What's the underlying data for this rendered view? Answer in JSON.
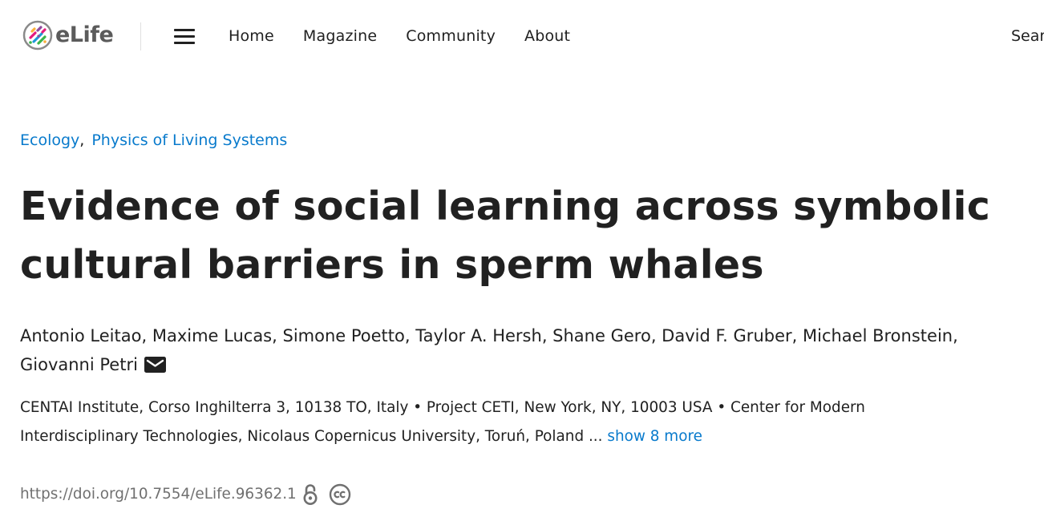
{
  "header": {
    "logo_text": "eLife",
    "nav": [
      {
        "label": "Home"
      },
      {
        "label": "Magazine"
      },
      {
        "label": "Community"
      },
      {
        "label": "About"
      }
    ],
    "search_label": "Search"
  },
  "article": {
    "subjects": [
      {
        "label": "Ecology"
      },
      {
        "label": "Physics of Living Systems"
      }
    ],
    "subject_separator": ",",
    "title_line1": "Evidence of social learning across symbolic",
    "title_line2": "cultural barriers in sperm whales",
    "authors": [
      "Antonio Leitao",
      "Maxime Lucas",
      "Simone Poetto",
      "Taylor A. Hersh",
      "Shane Gero",
      "David F. Gruber",
      "Michael Bronstein",
      "Giovanni Petri"
    ],
    "author_separator": ", ",
    "affiliations_text": "CENTAI Institute, Corso Inghilterra 3, 10138 TO, Italy • Project CETI, New York, NY, 10003 USA • Center for Modern Interdisciplinary Technologies, Nicolaus Copernicus University, Toruń, Poland ...",
    "show_more_label": "show 8 more",
    "doi": "https://doi.org/10.7554/eLife.96362.1"
  },
  "icons": {
    "menu": "hamburger-menu-icon",
    "email": "mail-icon",
    "open_access": "open-access-icon",
    "license": "creative-commons-icon"
  },
  "colors": {
    "link": "#087acc",
    "text": "#212121",
    "muted": "#707070"
  }
}
